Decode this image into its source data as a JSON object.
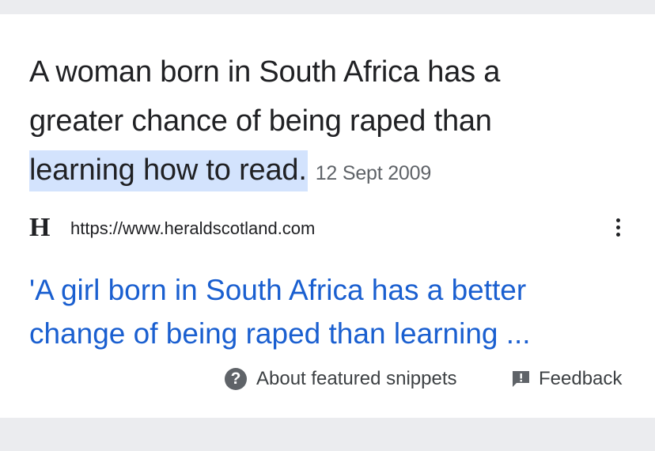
{
  "snippet": {
    "line1": "A woman born in South Africa has a",
    "line2": "greater chance of being raped than",
    "highlight": "learning how to read",
    "after_highlight": ".",
    "date": "12 Sept 2009"
  },
  "source": {
    "favicon_letter": "H",
    "url": "https://www.heraldscotland.com",
    "menu_icon": "more-vert-icon"
  },
  "result": {
    "title_line1": "'A girl born in South Africa has a better",
    "title_line2": "change of being raped than learning ..."
  },
  "footer": {
    "about_label": "About featured snippets",
    "about_icon": "help-circle-icon",
    "feedback_label": "Feedback",
    "feedback_icon": "feedback-icon"
  },
  "colors": {
    "highlight": "#d3e3fd",
    "link": "#1a5fd0",
    "text": "#202124",
    "muted": "#5f6368",
    "page_background": "#ebecef"
  }
}
